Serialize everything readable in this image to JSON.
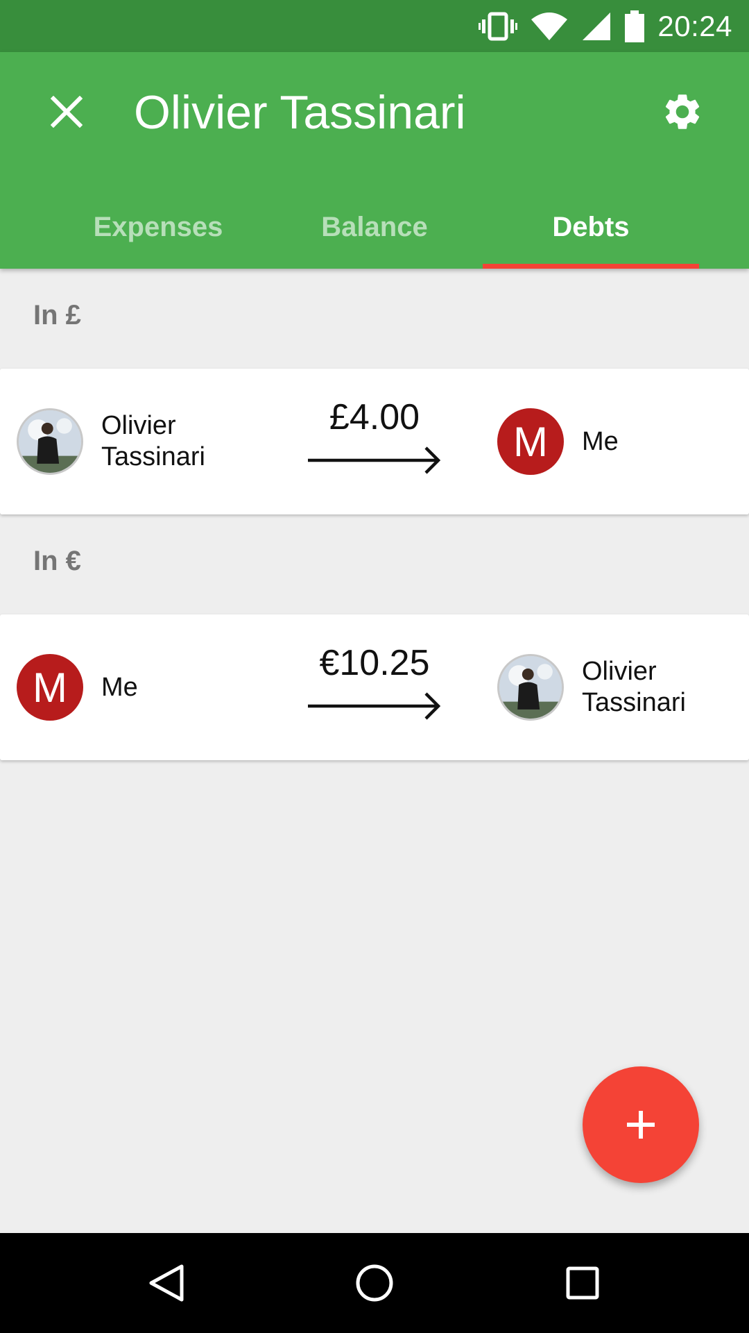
{
  "status_bar": {
    "time": "20:24",
    "icons": [
      "vibrate-icon",
      "wifi-icon",
      "cell-signal-icon",
      "battery-icon"
    ]
  },
  "app_bar": {
    "title": "Olivier Tassinari",
    "close_icon": "close-icon",
    "settings_icon": "gear-icon",
    "background_color": "#4caf50",
    "status_color": "#388e3c"
  },
  "tabs": [
    {
      "label": "Expenses",
      "active": false
    },
    {
      "label": "Balance",
      "active": false
    },
    {
      "label": "Debts",
      "active": true
    }
  ],
  "indicator_color": "#f44336",
  "debts": [
    {
      "currency_header": "In £",
      "from": {
        "name": "Olivier Tassinari",
        "avatar": "photo"
      },
      "amount": "£4.00",
      "to": {
        "name": "Me",
        "avatar": "letter",
        "letter": "M"
      }
    },
    {
      "currency_header": "In €",
      "from": {
        "name": "Me",
        "avatar": "letter",
        "letter": "M"
      },
      "amount": "€10.25",
      "to": {
        "name": "Olivier Tassinari",
        "avatar": "photo"
      }
    }
  ],
  "fab": {
    "icon": "plus-icon",
    "color": "#f44336"
  },
  "nav_bar": {
    "icons": [
      "back-icon",
      "home-icon",
      "recents-icon"
    ]
  }
}
